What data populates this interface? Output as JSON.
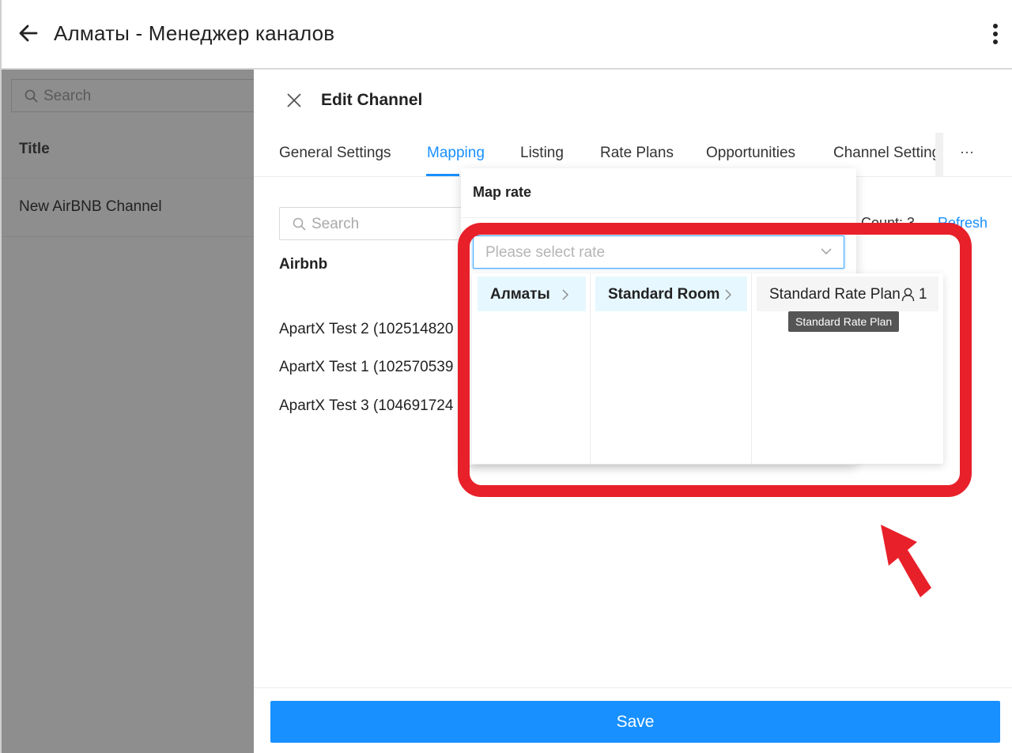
{
  "appbar": {
    "title": "Алматы - Менеджер каналов"
  },
  "sidebar": {
    "search_placeholder": "Search",
    "column_title": "Title",
    "items": [
      {
        "label": "New AirBNB Channel"
      }
    ]
  },
  "drawer": {
    "title": "Edit Channel",
    "tabs": [
      {
        "label": "General Settings"
      },
      {
        "label": "Mapping",
        "active": true
      },
      {
        "label": "Listing"
      },
      {
        "label": "Rate Plans"
      },
      {
        "label": "Opportunities"
      },
      {
        "label": "Channel Setting"
      }
    ],
    "more_tabs": "···",
    "search_placeholder": "Search",
    "count_text": "Count: 3",
    "refresh_label": "Refresh",
    "section_label": "Airbnb",
    "listings": [
      {
        "label": "ApartX Test 2 (102514820"
      },
      {
        "label": "ApartX Test 1 (102570539"
      },
      {
        "label": "ApartX Test 3 (104691724"
      }
    ],
    "save_label": "Save"
  },
  "map_rate": {
    "title": "Map rate",
    "select_placeholder": "Please select rate",
    "cascader": {
      "level1": "Алматы",
      "level2": "Standard Room",
      "level3": "Standard Rate Plan",
      "level3_occupancy": "1",
      "tooltip": "Standard Rate Plan"
    }
  },
  "colors": {
    "accent": "#1890ff",
    "highlight": "#e8202a",
    "overlay": "#8e8e8e"
  },
  "icons": [
    "back-arrow-icon",
    "kebab-menu-icon",
    "search-icon",
    "close-icon",
    "chevron-down-icon",
    "chevron-right-icon",
    "user-icon"
  ]
}
